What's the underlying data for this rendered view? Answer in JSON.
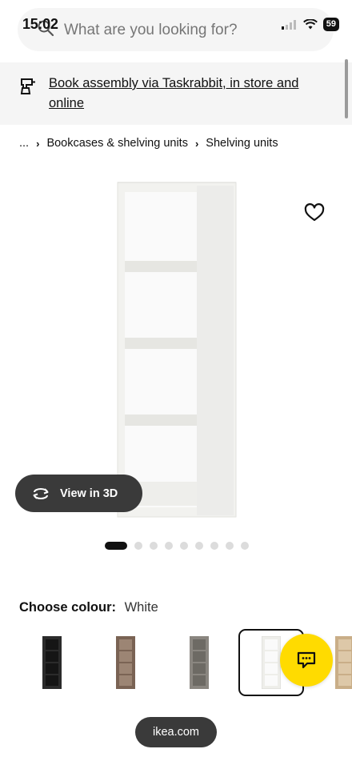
{
  "status_bar": {
    "time": "15:02",
    "battery": "59"
  },
  "search": {
    "placeholder": "What are you looking for?"
  },
  "banner": {
    "text": "Book assembly via Taskrabbit, in store and online"
  },
  "breadcrumb": {
    "ellipsis": "...",
    "items": [
      "Bookcases & shelving units",
      "Shelving units"
    ]
  },
  "product": {
    "view3d_label": "View in 3D",
    "image_count": 9,
    "active_image": 1
  },
  "colour": {
    "label": "Choose colour:",
    "value": "White",
    "swatches": [
      {
        "name": "black-brown",
        "color": "#2b2b2b"
      },
      {
        "name": "walnut",
        "color": "#7a6354"
      },
      {
        "name": "grey",
        "color": "#8a8680"
      },
      {
        "name": "white",
        "color": "#eeeeea",
        "selected": true
      },
      {
        "name": "oak",
        "color": "#c9ae88"
      }
    ]
  },
  "footer": {
    "url": "ikea.com"
  },
  "colors": {
    "accent_yellow": "#ffdb00",
    "dark_pill": "#3a3a3a"
  }
}
